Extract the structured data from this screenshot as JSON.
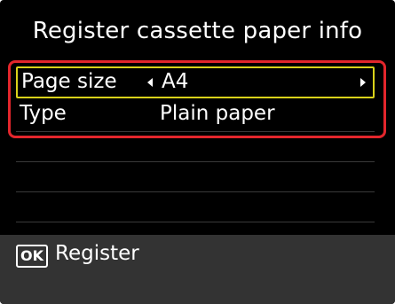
{
  "screen": {
    "title": "Register cassette paper info"
  },
  "settings": {
    "page_size": {
      "label": "Page size",
      "value": "A4",
      "has_left_arrow": true,
      "has_right_arrow": true
    },
    "type": {
      "label": "Type",
      "value": "Plain paper"
    }
  },
  "footer": {
    "ok_button_label": "OK",
    "action_label": "Register"
  },
  "colors": {
    "background": "#000000",
    "text": "#ffffff",
    "selection_border": "#d9d21a",
    "annotation_frame": "#e3262c",
    "footer_background": "#333333"
  },
  "icons": [
    "left-arrow-icon",
    "right-arrow-icon"
  ]
}
